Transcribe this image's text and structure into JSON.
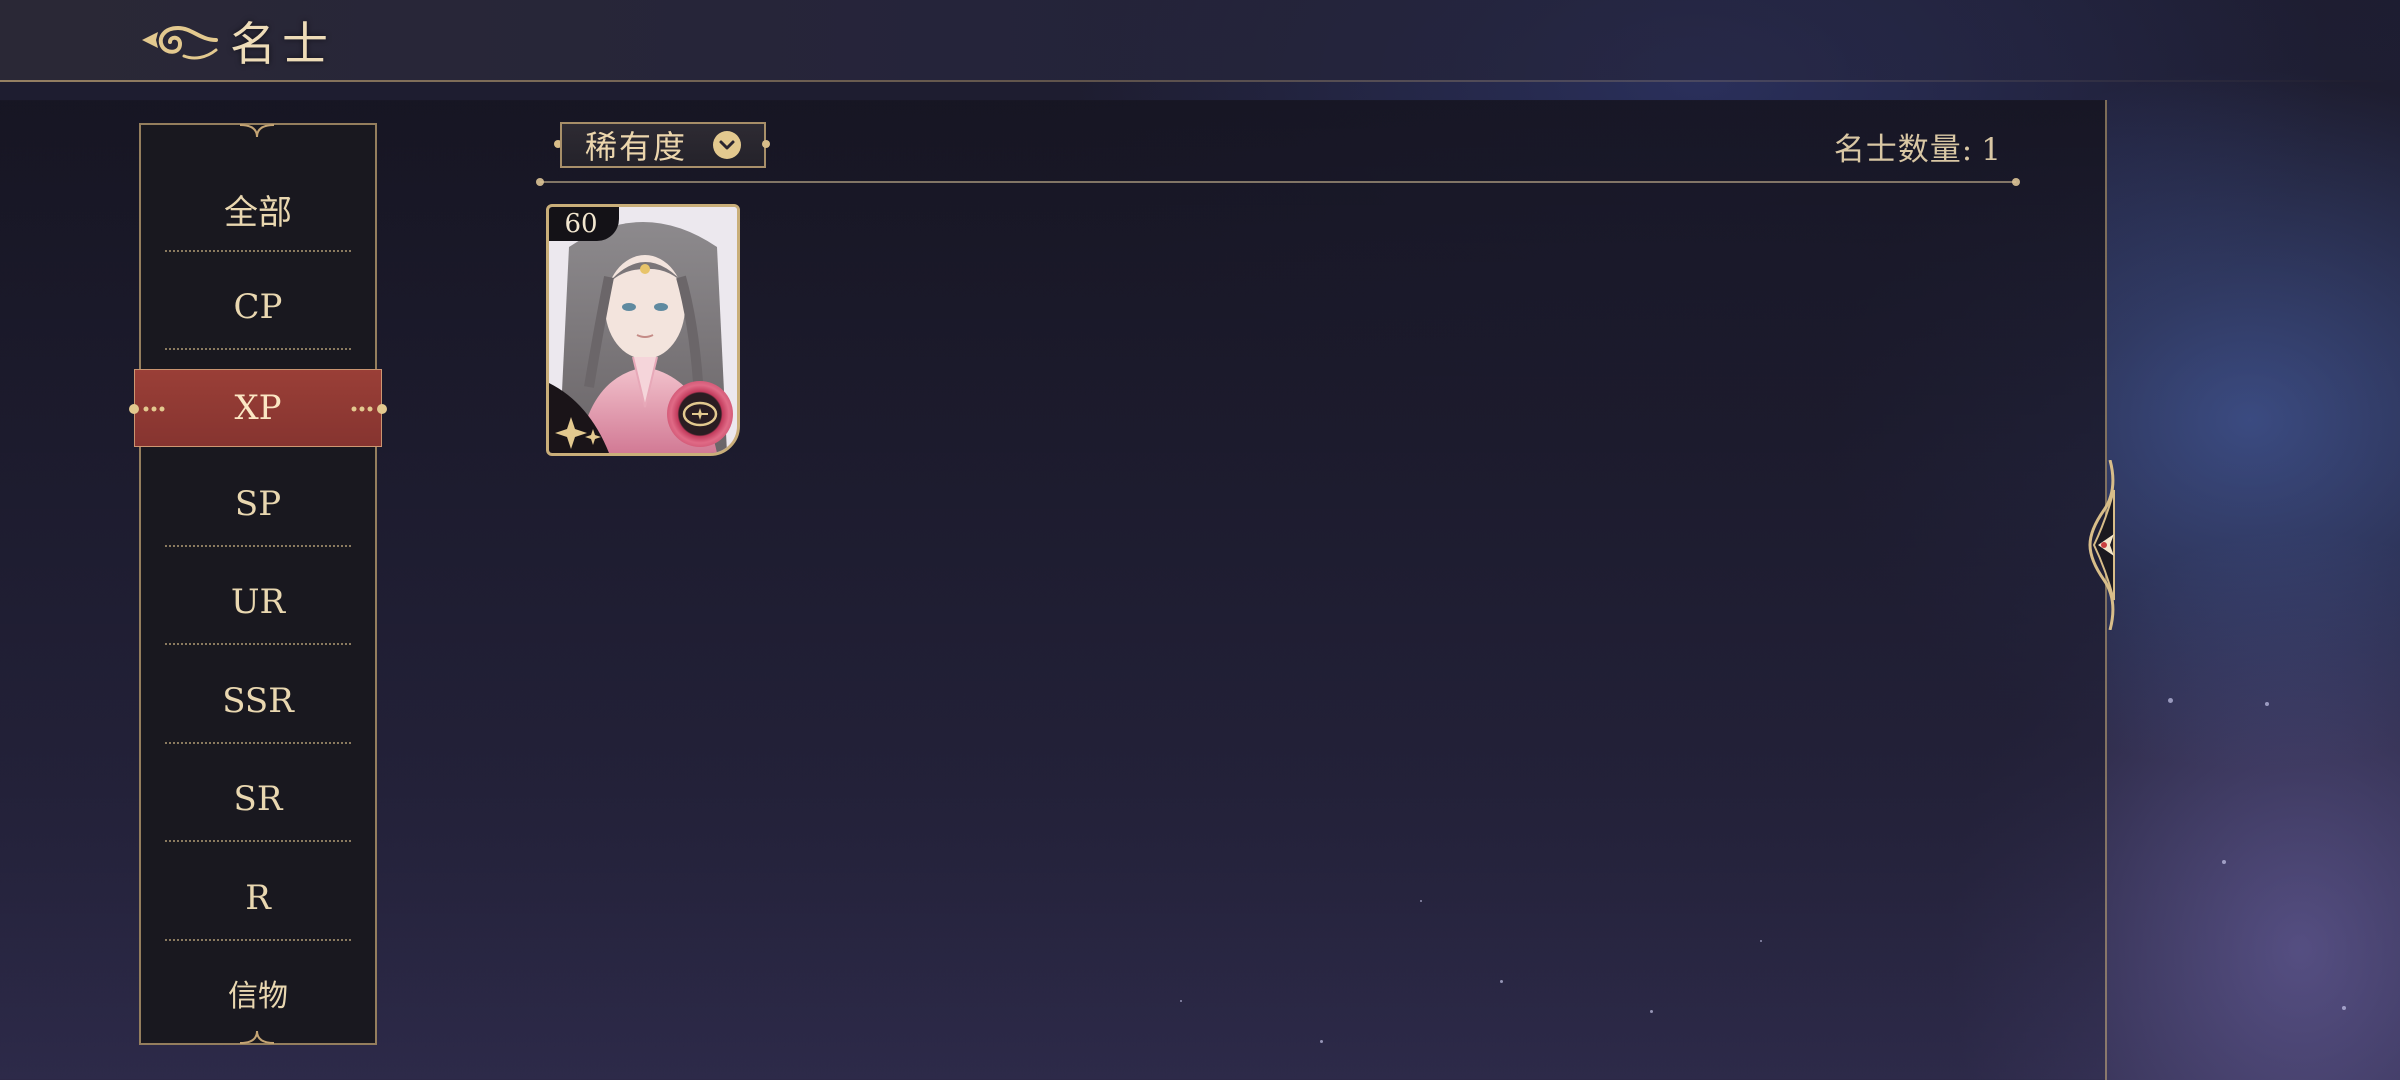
{
  "header": {
    "title": "名士",
    "back_icon": "cloud-scroll-back-icon"
  },
  "sidebar": {
    "items": [
      {
        "label": "全部"
      },
      {
        "label": "CP"
      },
      {
        "label": "XP"
      },
      {
        "label": "SP"
      },
      {
        "label": "UR"
      },
      {
        "label": "SSR"
      },
      {
        "label": "SR"
      },
      {
        "label": "R"
      },
      {
        "label": "信物"
      }
    ],
    "active_index": 2,
    "active_color": "#8f3933"
  },
  "filter": {
    "label": "稀有度",
    "icon": "chevron-down-icon"
  },
  "count": {
    "label": "名士数量:",
    "value": "1"
  },
  "characters": [
    {
      "level": "60"
    }
  ],
  "colors": {
    "gold": "#e3c98f",
    "panel": "#19181f",
    "text": "#e9d7b0"
  }
}
